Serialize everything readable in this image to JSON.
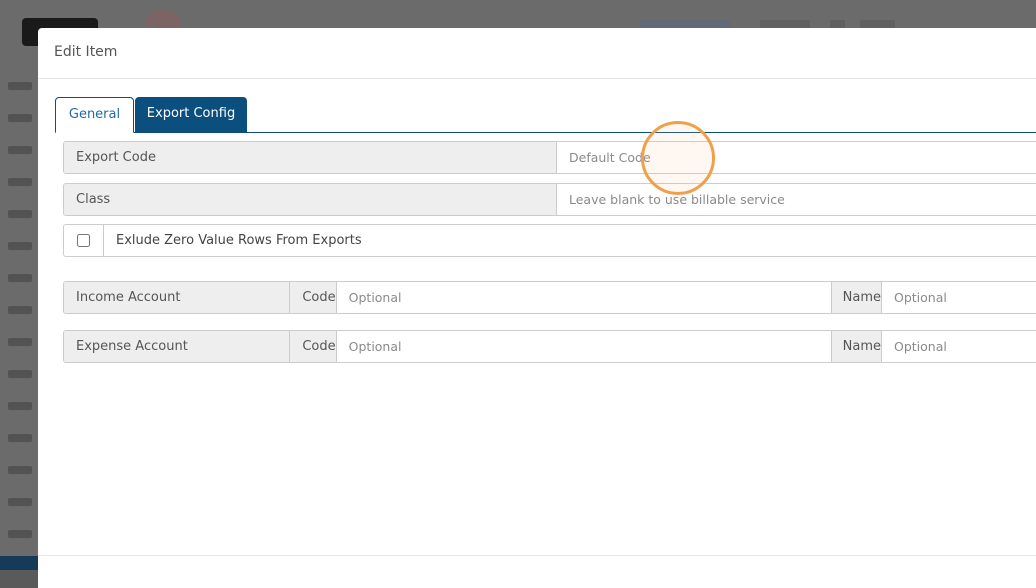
{
  "modal": {
    "title": "Edit Item"
  },
  "tabs": [
    {
      "label": "General",
      "active": false
    },
    {
      "label": "Export Config",
      "active": true
    }
  ],
  "form": {
    "export_code": {
      "label": "Export Code",
      "value": "",
      "placeholder": "Default Code"
    },
    "class": {
      "label": "Class",
      "value": "",
      "placeholder": "Leave blank to use billable service"
    },
    "exclude_zero": {
      "label": "Exlude Zero Value Rows From Exports",
      "checked": false
    },
    "income_account": {
      "label": "Income Account",
      "code_label": "Code",
      "code_placeholder": "Optional",
      "name_label": "Name",
      "name_placeholder": "Optional"
    },
    "expense_account": {
      "label": "Expense Account",
      "code_label": "Code",
      "code_placeholder": "Optional",
      "name_label": "Name",
      "name_placeholder": "Optional"
    }
  },
  "colors": {
    "accent": "#0b4f7f",
    "addon_bg": "#eeeeee",
    "cursor_highlight": "#f0a04a"
  }
}
